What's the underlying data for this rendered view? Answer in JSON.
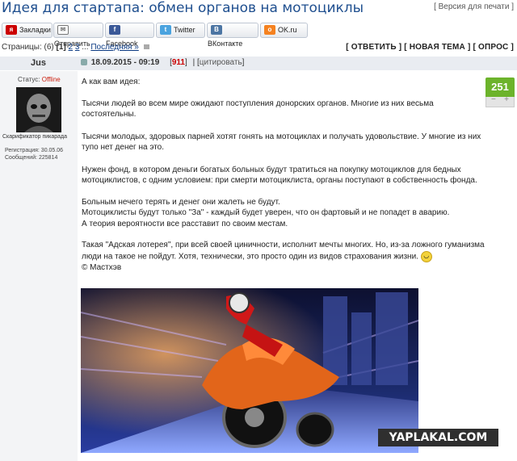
{
  "title": "Идея для стартапа: обмен органов на мотоциклы",
  "print_link": "[ Версия для печати ]",
  "share": {
    "bookmarks": "Закладки",
    "send": "Отправить",
    "facebook": "Facebook",
    "twitter": "Twitter",
    "vkontakte": "ВКонтакте",
    "okru": "OK.ru"
  },
  "pager": {
    "prefix": "Страницы: (6)",
    "current": "[1]",
    "p2": "2",
    "p3": "3",
    "ellipsis": "...",
    "last": "Последняя »"
  },
  "actions": {
    "reply": "[ ОТВЕТИТЬ ]",
    "new_topic": "[ НОВАЯ ТЕМА ]",
    "poll": "[ ОПРОС ]"
  },
  "author": {
    "name": "Jus",
    "status_label": "Статус:",
    "status": "Offline",
    "rank": "Скарификатор пикарада",
    "registration": "Регистрация: 30.05.06",
    "messages": "Сообщений: 225814"
  },
  "post": {
    "date": "18.09.2015 - 09:19",
    "number": "911",
    "quote": "цитировать",
    "score": "251",
    "lines": [
      "А как вам идея:",
      "Тысячи людей во всем мире ожидают поступления донорских органов. Многие из них весьма состоятельны.",
      "Тысячи молодых, здоровых парней хотят гонять на мотоциклах и получать удовольствие. У многие из них тупо нет денег на это.",
      "Нужен фонд, в котором деньги богатых больных будут тратиться на покупку мотоциклов для бедных мотоциклистов, с одним условием: при смерти мотоциклиста, органы поступают в собственность фонда.",
      "Больным нечего терять и денег они жалеть не будут.",
      "Мотоциклисты будут только \"За\" - каждый будет уверен, что он фартовый и не попадет в аварию.",
      "А теория вероятности все расставит по своим местам.",
      "Такая \"Адская лотерея\", при всей своей циничности, исполнит мечты многих. Но, из-за ложного гуманизма люди на такое не пойдут. Хотя, технически, это просто один из видов страхования жизни.",
      "© Мастхэв"
    ]
  },
  "watermark": "YAPLAKAL.COM"
}
